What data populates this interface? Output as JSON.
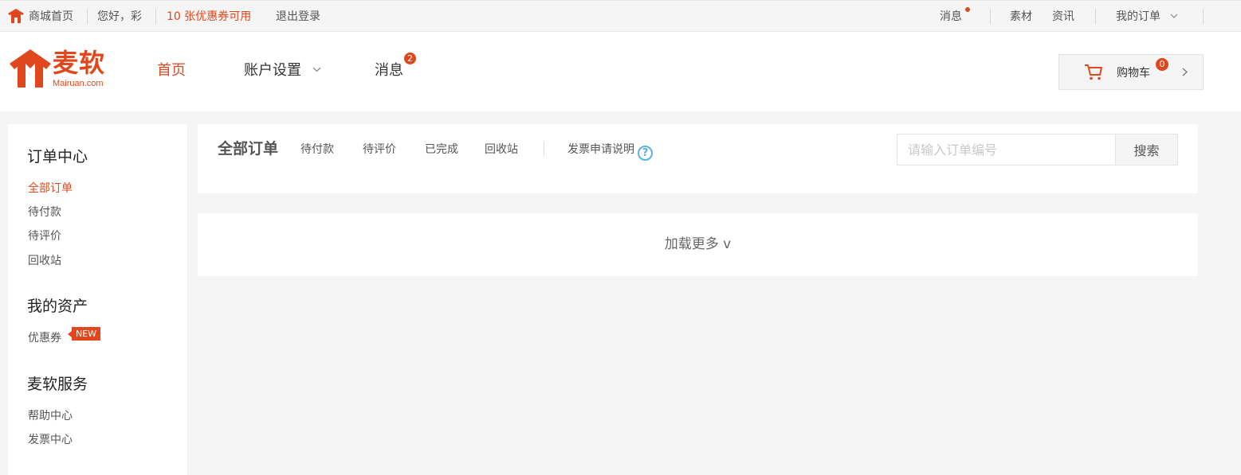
{
  "topbar": {
    "home": "商城首页",
    "greeting": "您好，彩",
    "coupons": "10 张优惠券可用",
    "logout": "退出登录",
    "messages": "消息",
    "materials": "素材",
    "news": "资讯",
    "my_orders": "我的订单"
  },
  "header": {
    "logo_text": "麦软",
    "logo_sub": "Mairuan.com",
    "nav": {
      "home": "首页",
      "account": "账户设置",
      "messages": "消息",
      "messages_badge": "2"
    },
    "cart": {
      "label": "购物车",
      "count": "0"
    }
  },
  "sidebar": {
    "order_center": {
      "title": "订单中心",
      "items": [
        "全部订单",
        "待付款",
        "待评价",
        "回收站"
      ]
    },
    "assets": {
      "title": "我的资产",
      "coupons": "优惠券",
      "new_tag": "NEW"
    },
    "services": {
      "title": "麦软服务",
      "items": [
        "帮助中心",
        "发票中心"
      ]
    }
  },
  "orders": {
    "tabs": {
      "all": "全部订单",
      "pending_payment": "待付款",
      "pending_review": "待评价",
      "completed": "已完成",
      "recycle": "回收站",
      "invoice": "发票申请说明",
      "help": "?"
    },
    "search": {
      "placeholder": "请输入订单编号",
      "button": "搜索"
    },
    "load_more": "加载更多 v"
  },
  "colors": {
    "accent": "#e0471c",
    "help_blue": "#5ab1e3",
    "background": "#f5f5f5"
  }
}
